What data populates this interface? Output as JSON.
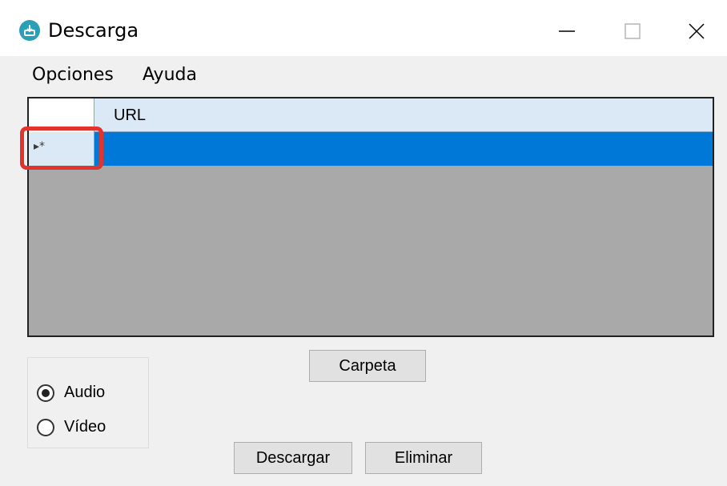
{
  "window": {
    "title": "Descarga",
    "controls": {
      "minimize_icon": "minimize-icon",
      "maximize_icon": "maximize-icon",
      "close_icon": "close-icon"
    }
  },
  "menu": {
    "items": [
      {
        "label": "Opciones"
      },
      {
        "label": "Ayuda"
      }
    ]
  },
  "grid": {
    "columns": [
      "URL"
    ],
    "rows": [
      {
        "marker": "▸*",
        "url": ""
      }
    ],
    "selected_color": "#0078d7",
    "header_color": "#dbe9f6",
    "empty_color": "#a9a9a9"
  },
  "format": {
    "options": [
      {
        "label": "Audio",
        "selected": true
      },
      {
        "label": "Vídeo",
        "selected": false
      }
    ]
  },
  "buttons": {
    "carpeta": "Carpeta",
    "descargar": "Descargar",
    "eliminar": "Eliminar"
  },
  "highlight_color": "#e2342e"
}
